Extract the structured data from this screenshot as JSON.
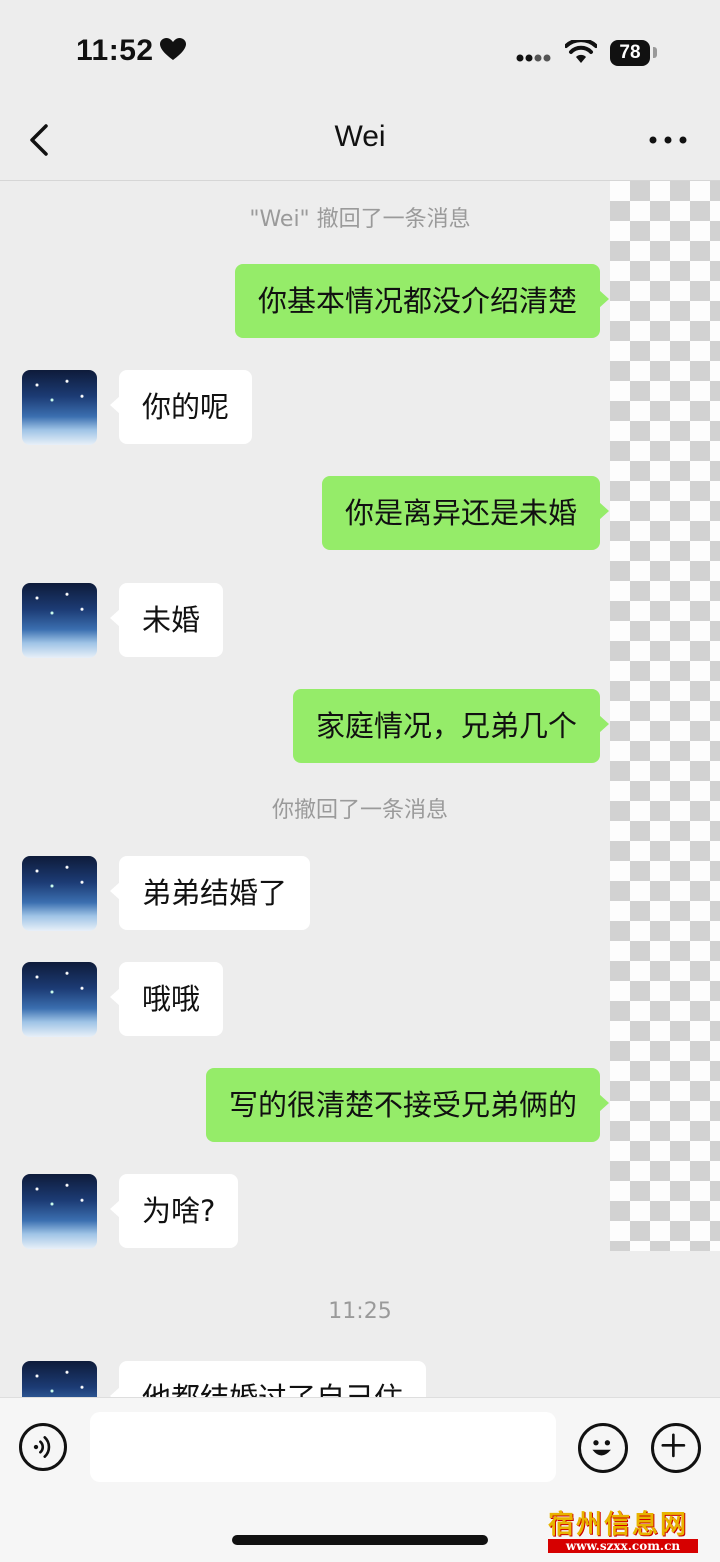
{
  "status_bar": {
    "time": "11:52",
    "battery": "78"
  },
  "header": {
    "title": "Wei"
  },
  "messages": [
    {
      "type": "system",
      "text": "\"Wei\" 撤回了一条消息"
    },
    {
      "type": "out",
      "text": "你基本情况都没介绍清楚"
    },
    {
      "type": "in",
      "text": "你的呢"
    },
    {
      "type": "out",
      "text": "你是离异还是未婚"
    },
    {
      "type": "in",
      "text": "未婚"
    },
    {
      "type": "out",
      "text": "家庭情况，兄弟几个"
    },
    {
      "type": "system",
      "text": "你撤回了一条消息"
    },
    {
      "type": "in",
      "text": "弟弟结婚了"
    },
    {
      "type": "in",
      "text": "哦哦"
    },
    {
      "type": "out",
      "text": "写的很清楚不接受兄弟俩的"
    },
    {
      "type": "in",
      "text": "为啥?"
    },
    {
      "type": "system",
      "text": "11:25"
    },
    {
      "type": "in",
      "text": "他都结婚过了自己住"
    }
  ],
  "watermark": {
    "name": "宿州信息网",
    "site": "www.szxx.com.cn"
  }
}
